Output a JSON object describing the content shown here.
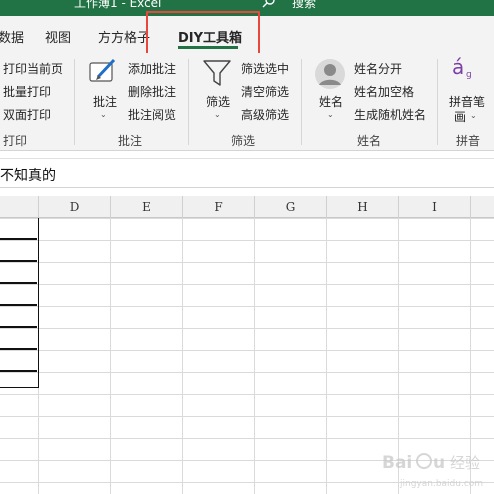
{
  "titlebar": {
    "title": "工作薄1 - Excel",
    "search_label": "搜索"
  },
  "tabs": [
    {
      "label": "数据"
    },
    {
      "label": "视图"
    },
    {
      "label": "方方格子"
    },
    {
      "label": "DIY工具箱"
    }
  ],
  "ribbon": {
    "print": {
      "items": [
        "打印当前页",
        "批量打印",
        "双面打印"
      ],
      "label": "打印"
    },
    "comments": {
      "button": "批注",
      "items": [
        "添加批注",
        "删除批注",
        "批注阅览"
      ],
      "label": "批注"
    },
    "filter": {
      "button": "筛选",
      "items": [
        "筛选选中",
        "清空筛选",
        "高级筛选"
      ],
      "label": "筛选"
    },
    "name": {
      "button": "姓名",
      "items": [
        "姓名分开",
        "姓名加空格",
        "生成随机姓名"
      ],
      "label": "姓名"
    },
    "pinyin": {
      "button_line1": "拼音笔",
      "button_line2": "画",
      "label": "拼音",
      "glyph": "á"
    }
  },
  "formula": {
    "value": "不知真的"
  },
  "columns": [
    "D",
    "E",
    "F",
    "G",
    "H",
    "I"
  ],
  "watermark": {
    "text": "Baidu 经验",
    "url": "jingyan.baidu.com"
  },
  "colors": {
    "excel_green": "#217346",
    "highlight_red": "#e8473e"
  }
}
